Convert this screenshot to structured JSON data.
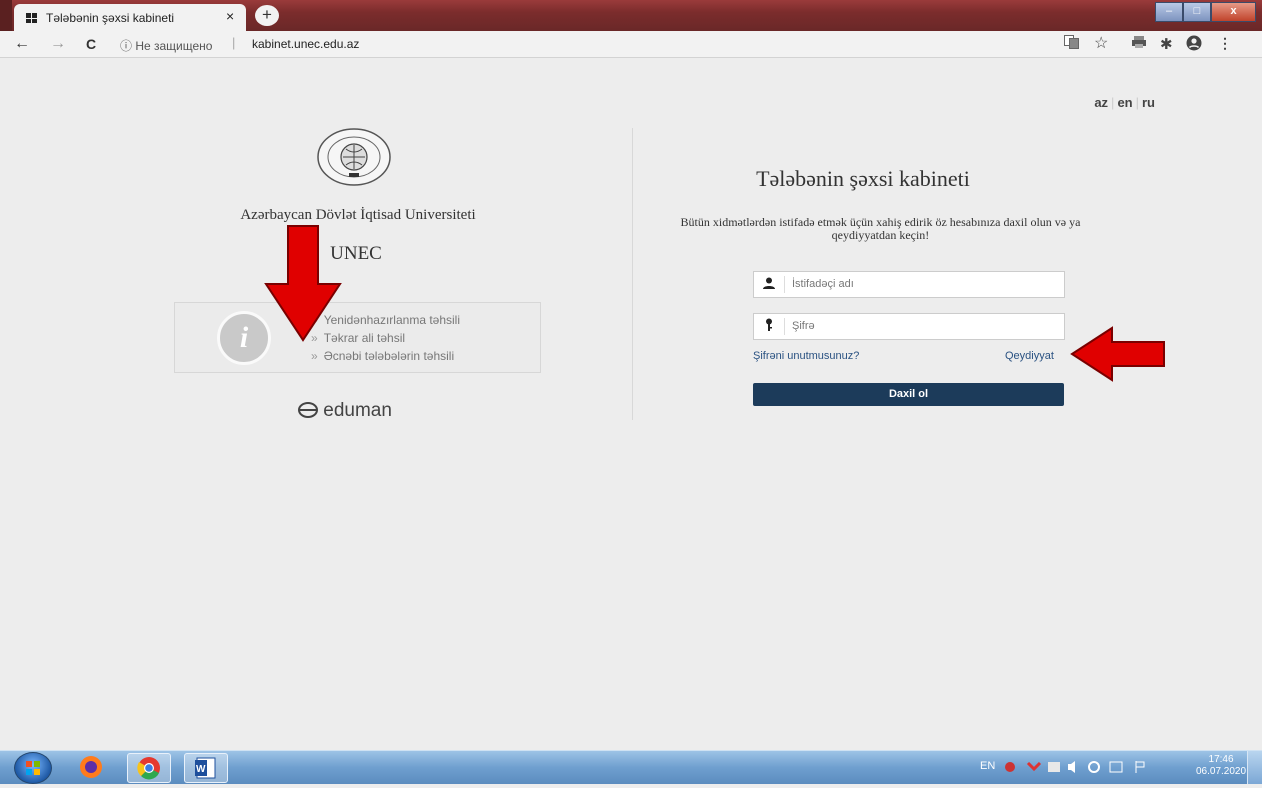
{
  "browser": {
    "tab_title": "Tələbənin şəxsi kabineti",
    "tab_close": "×",
    "new_tab": "+",
    "nav_back": "←",
    "nav_forward": "→",
    "nav_reload": "C",
    "security_text": "ⓘ Не защищено",
    "separator": "|",
    "url": "kabinet.unec.edu.az",
    "window_minimize": "–",
    "window_maximize": "□",
    "window_close": "x"
  },
  "lang": {
    "az": "az",
    "en": "en",
    "ru": "ru"
  },
  "left": {
    "university_name": "Azərbaycan Dövlət İqtisad Universiteti",
    "short_name": "UNEC",
    "info_links": [
      {
        "label": "Yenidənhazırlanma təhsili"
      },
      {
        "label": "Təkrar ali təhsil"
      },
      {
        "label": "Əcnəbi tələbələrin təhsili"
      }
    ],
    "link_chevron": "»",
    "info_glyph": "i",
    "eduman_label": "eduman"
  },
  "login": {
    "title": "Tələbənin şəxsi kabineti",
    "subtitle": "Bütün xidmətlərdən istifadə etmək üçün xahiş edirik öz hesabınıza daxil olun və ya qeydiyyatdan keçin!",
    "username_placeholder": "İstifadəçi adı",
    "password_placeholder": "Şifrə",
    "forgot_password": "Şifrəni unutmusunuz?",
    "register": "Qeydiyyat",
    "submit": "Daxil ol"
  },
  "taskbar": {
    "lang_indicator": "EN",
    "time": "17:46",
    "date": "06.07.2020"
  },
  "colors": {
    "accent_button": "#1c3b5a",
    "arrow_red": "#e00000",
    "page_bg": "#ededed"
  }
}
